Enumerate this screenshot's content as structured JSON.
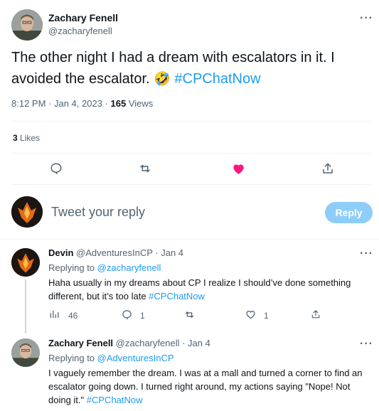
{
  "tweet": {
    "author_name": "Zachary Fenell",
    "author_handle": "@zacharyfenell",
    "more_glyph": "···",
    "text_before": "The other night I had a dream with escalators in it. I avoided the escalator.",
    "emoji": "🤣",
    "hashtag": "#CPChatNow",
    "time": "8:12 PM",
    "sep": " · ",
    "date": "Jan 4, 2023",
    "sep2": " · ",
    "views_count": "165",
    "views_label": " Views",
    "likes_count": "3",
    "likes_label": " Likes"
  },
  "composer": {
    "placeholder": "Tweet your reply",
    "button": "Reply"
  },
  "replies": [
    {
      "author_name": "Devin",
      "author_handle": "@AdventuresInCP",
      "date": " · Jan 4",
      "replying_to_label": "Replying to ",
      "replying_to": "@zacharyfenell",
      "text": "Haha usually in my dreams about CP I realize I should’ve done something different, but it’s too late ",
      "hashtag": "#CPChatNow",
      "views": "46",
      "comments": "1",
      "likes": "1"
    },
    {
      "author_name": "Zachary Fenell",
      "author_handle": "@zacharyfenell",
      "date": " · Jan 4",
      "replying_to_label": "Replying to ",
      "replying_to": "@AdventuresInCP",
      "text": "I vaguely remember the dream. I was at a mall and turned a corner to find an escalator going down. I turned right around, my actions saying \"Nope! Not doing it.\" ",
      "hashtag": "#CPChatNow"
    }
  ],
  "colors": {
    "accent": "#1d9bf0",
    "like": "#f91880",
    "muted": "#536471"
  }
}
